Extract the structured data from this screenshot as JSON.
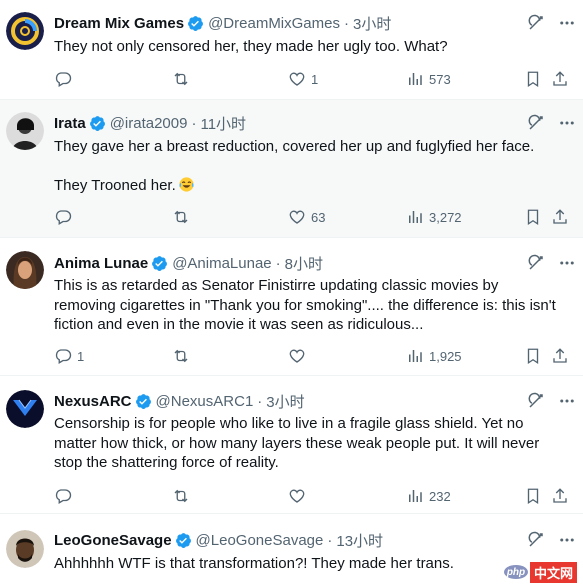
{
  "tweets": [
    {
      "name": "Dream Mix Games",
      "handle": "@DreamMixGames",
      "time": "3小时",
      "lines": [
        "They not only censored her, they made her ugly too. What?"
      ],
      "replies": "",
      "retweets": "",
      "likes": "1",
      "views": "573"
    },
    {
      "name": "Irata",
      "handle": "@irata2009",
      "time": "11小时",
      "lines": [
        "They gave her a breast reduction, covered her up and fuglyfied her face.",
        "",
        "They Trooned her."
      ],
      "emoji": "face-with-tears-of-joy",
      "replies": "",
      "retweets": "",
      "likes": "63",
      "views": "3,272"
    },
    {
      "name": "Anima Lunae",
      "handle": "@AnimaLunae",
      "time": "8小时",
      "lines": [
        "This is as retarded as Senator Finistirre updating classic movies by",
        "removing cigarettes in \"Thank you for smoking\".... the difference is: this isn't",
        "fiction and even in the movie it was seen as ridiculous..."
      ],
      "replies": "1",
      "retweets": "",
      "likes": "",
      "views": "1,925"
    },
    {
      "name": "NexusARC",
      "handle": "@NexusARC1",
      "time": "3小时",
      "lines": [
        "Censorship is for people who like to live in a fragile glass shield. Yet no",
        "matter how thick, or how many layers these weak people put. It will never",
        "stop the shattering force of reality."
      ],
      "replies": "",
      "retweets": "",
      "likes": "",
      "views": "232"
    },
    {
      "name": "LeoGoneSavage",
      "handle": "@LeoGoneSavage",
      "time": "13小时",
      "lines": [
        "Ahhhhhh WTF is that transformation?! They made her trans."
      ]
    }
  ],
  "separator": "·",
  "watermark": {
    "logo": "php",
    "text": "中文网"
  },
  "colors": {
    "verified": "#1d9bf0",
    "secondary_text": "#536471",
    "highlight_bg": "#f7f9f9"
  }
}
